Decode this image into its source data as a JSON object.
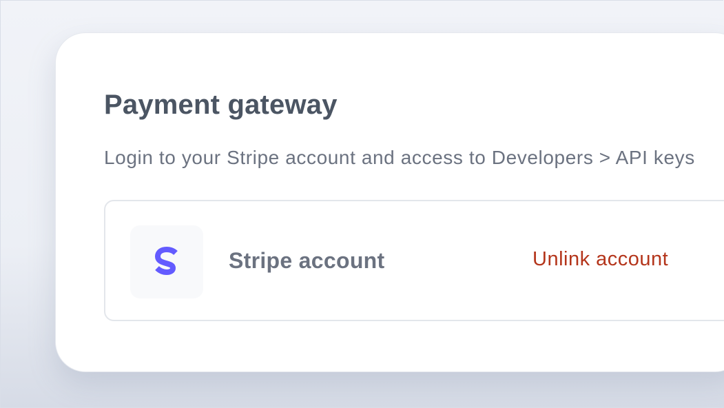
{
  "panel": {
    "title": "Payment gateway",
    "description": "Login to your Stripe account and access to Developers > API keys"
  },
  "account": {
    "logo_letter": "S",
    "logo_icon": "stripe-logo-icon",
    "name": "Stripe account",
    "unlink_label": "Unlink account"
  },
  "colors": {
    "stripe_brand": "#635bff",
    "unlink": "#b4351b",
    "title": "#4b5563",
    "muted_text": "#6b7280"
  }
}
